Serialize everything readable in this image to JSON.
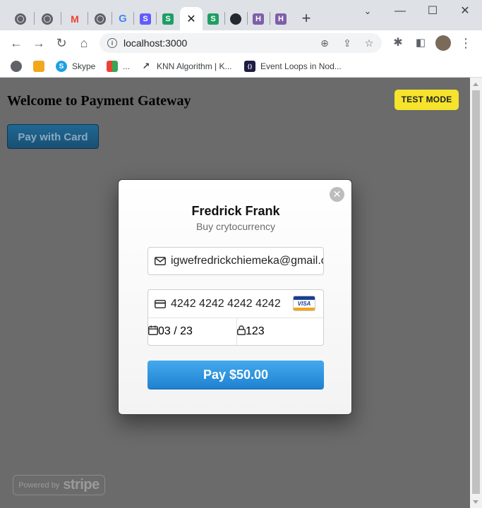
{
  "browser": {
    "tabs": [
      {
        "icon": "globe-icon"
      },
      {
        "icon": "globe-icon"
      },
      {
        "icon": "gmail-icon",
        "letter": "M",
        "color": "#ea4335"
      },
      {
        "icon": "globe-icon"
      },
      {
        "icon": "google-icon",
        "letter": "G",
        "color": "#4285f4"
      },
      {
        "icon": "stripe-s-icon",
        "letter": "S",
        "color": "#635bff"
      },
      {
        "icon": "sheet-s-icon",
        "letter": "S",
        "color": "#1e9e64"
      },
      {
        "icon": "close-icon",
        "active": true
      },
      {
        "icon": "sheet-s-icon",
        "letter": "S",
        "color": "#1e9e64"
      },
      {
        "icon": "github-icon"
      },
      {
        "icon": "heroku-icon",
        "letter": "H",
        "color": "#7e5fa8"
      },
      {
        "icon": "heroku-icon",
        "letter": "H",
        "color": "#7e5fa8"
      }
    ],
    "new_tab": "+",
    "url": "localhost:3000",
    "bookmarks": [
      {
        "label": "",
        "icon": "globe-icon"
      },
      {
        "label": "",
        "icon": "bookmark-app-icon",
        "color": "#f2a81d"
      },
      {
        "label": "Skype",
        "icon": "skype-icon",
        "color": "#1ea0e4"
      },
      {
        "label": "...",
        "icon": "puzzle-color-icon",
        "color": "#34a853"
      },
      {
        "label": "KNN Algorithm | K...",
        "icon": "chart-line-icon"
      },
      {
        "label": "Event Loops in Nod...",
        "icon": "event-loop-icon",
        "color": "#1d1d45"
      }
    ]
  },
  "page": {
    "title": "Welcome to Payment Gateway",
    "pay_with_card": "Pay with Card",
    "test_mode": "TEST MODE",
    "powered_by": "Powered by",
    "powered_brand": "stripe"
  },
  "checkout": {
    "name": "Fredrick Frank",
    "description": "Buy crytocurrency",
    "email": "igwefredrickchiemeka@gmail.com",
    "card_number": "4242 4242 4242 4242",
    "card_brand": "VISA",
    "expiry": "03 / 23",
    "cvc": "123",
    "pay_button": "Pay $50.00",
    "close_symbol": "✕"
  }
}
